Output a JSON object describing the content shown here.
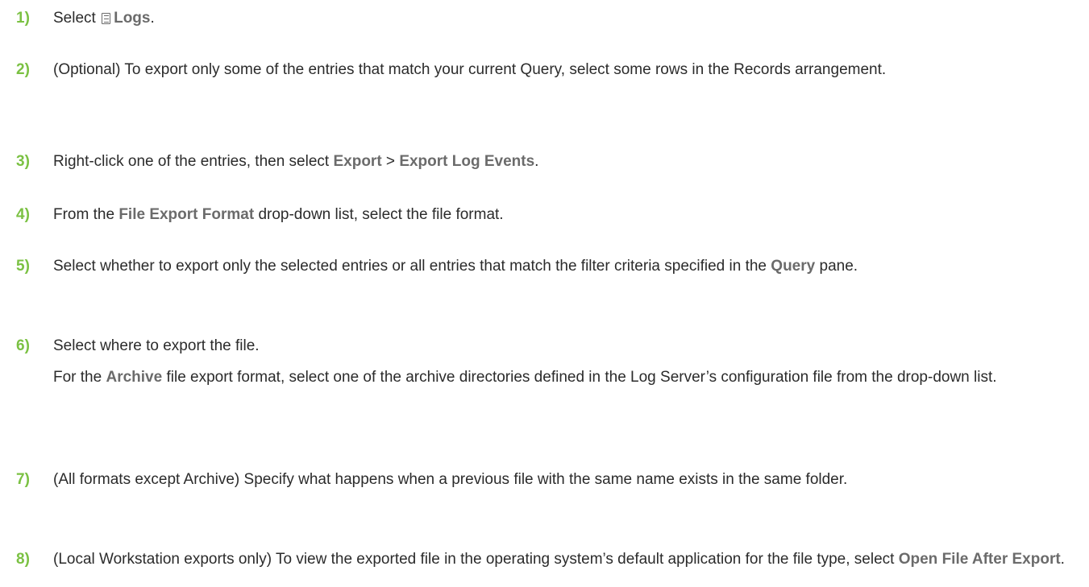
{
  "colors": {
    "step_number": "#7bc143",
    "text": "#2b2b2b",
    "ui_term": "#6b6b6b"
  },
  "steps": [
    {
      "number": "1)",
      "before": "Select",
      "icon": "logs-icon",
      "term": "Logs",
      "after": "."
    },
    {
      "number": "2)",
      "text": "(Optional) To export only some of the entries that match your current Query, select some rows in the Records arrangement."
    },
    {
      "number": "3)",
      "before": "Right-click one of the entries, then select ",
      "term1": "Export",
      "separator": " > ",
      "term2": "Export Log Events",
      "after": "."
    },
    {
      "number": "4)",
      "before": "From the ",
      "term": "File Export Format",
      "after": " drop-down list, select the file format."
    },
    {
      "number": "5)",
      "before": "Select whether to export only the selected entries or all entries that match the filter criteria specified in the ",
      "term": "Query",
      "after": " pane."
    },
    {
      "number": "6)",
      "text": "Select where to export the file.",
      "sub_before": "For the ",
      "sub_term": "Archive",
      "sub_after": " file export format, select one of the archive directories defined in the Log Server’s configuration file from the drop-down list."
    },
    {
      "number": "7)",
      "text": "(All formats except Archive) Specify what happens when a previous file with the same name exists in the same folder."
    },
    {
      "number": "8)",
      "before": "(Local Workstation exports only) To view the exported file in the operating system’s default application for the file type, select ",
      "term": "Open File After Export",
      "after": "."
    }
  ]
}
